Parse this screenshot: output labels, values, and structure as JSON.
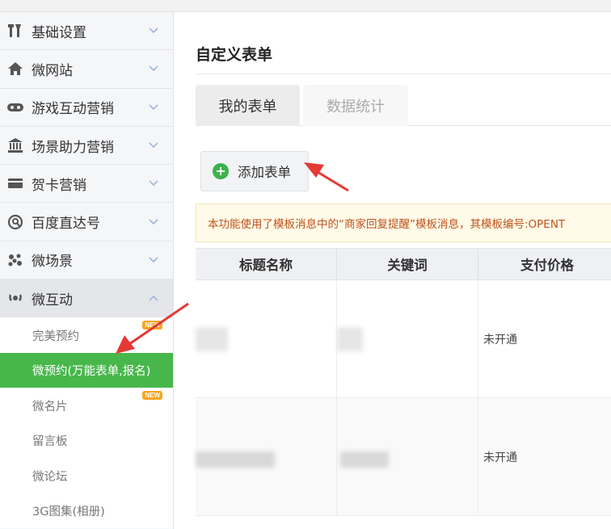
{
  "sidebar": {
    "items": [
      {
        "label": "基础设置",
        "icon": "tools-icon"
      },
      {
        "label": "微网站",
        "icon": "home-icon"
      },
      {
        "label": "游戏互动营销",
        "icon": "gamepad-icon"
      },
      {
        "label": "场景助力营销",
        "icon": "bank-icon"
      },
      {
        "label": "贺卡营销",
        "icon": "card-icon"
      },
      {
        "label": "百度直达号",
        "icon": "search-circle-icon"
      },
      {
        "label": "微场景",
        "icon": "scene-icon"
      },
      {
        "label": "微互动",
        "icon": "interaction-icon"
      }
    ],
    "sub_items": [
      {
        "label": "完美预约",
        "badge": "NEW"
      },
      {
        "label": "微预约(万能表单,报名)",
        "badge": ""
      },
      {
        "label": "微名片",
        "badge": "NEW"
      },
      {
        "label": "留言板",
        "badge": ""
      },
      {
        "label": "微论坛",
        "badge": ""
      },
      {
        "label": "3G图集(相册)",
        "badge": ""
      }
    ]
  },
  "main": {
    "title": "自定义表单",
    "tabs": [
      {
        "label": "我的表单"
      },
      {
        "label": "数据统计"
      }
    ],
    "add_button": "添加表单",
    "notice": "本功能使用了模板消息中的“商家回复提醒”模板消息，其模板编号:OPENT",
    "table": {
      "headers": [
        "标题名称",
        "关键词",
        "支付价格"
      ],
      "rows": [
        {
          "price": "未开通"
        },
        {
          "price": "未开通"
        }
      ]
    }
  },
  "colors": {
    "active_green": "#48b74b",
    "notice_text": "#c0521c",
    "arrow_red": "#e53935"
  }
}
